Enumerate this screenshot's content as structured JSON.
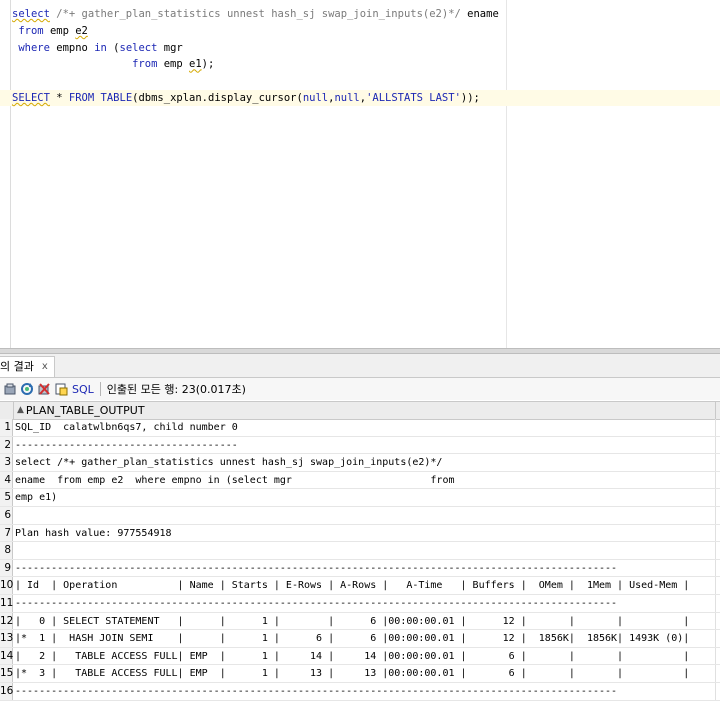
{
  "editor": {
    "lines": [
      {
        "parts": [
          {
            "t": "select",
            "c": "kw squig"
          },
          {
            "t": " "
          },
          {
            "t": "/*+ gather_plan_statistics unnest hash_sj swap_join_inputs(e2)*/",
            "c": "cm"
          },
          {
            "t": " ename"
          }
        ]
      },
      {
        "parts": [
          {
            "t": " "
          },
          {
            "t": "from",
            "c": "kw"
          },
          {
            "t": " emp "
          },
          {
            "t": "e2",
            "c": "squig"
          }
        ]
      },
      {
        "parts": [
          {
            "t": " "
          },
          {
            "t": "where",
            "c": "kw"
          },
          {
            "t": " empno "
          },
          {
            "t": "in",
            "c": "kw"
          },
          {
            "t": " ("
          },
          {
            "t": "select",
            "c": "kw"
          },
          {
            "t": " mgr"
          }
        ]
      },
      {
        "parts": [
          {
            "t": "                   "
          },
          {
            "t": "from",
            "c": "kw"
          },
          {
            "t": " emp "
          },
          {
            "t": "e1",
            "c": "squig"
          },
          {
            "t": ");"
          }
        ]
      },
      {
        "parts": []
      },
      {
        "parts": [
          {
            "t": "SELECT",
            "c": "kw squig"
          },
          {
            "t": " * "
          },
          {
            "t": "FROM",
            "c": "kw"
          },
          {
            "t": " "
          },
          {
            "t": "TABLE",
            "c": "kw"
          },
          {
            "t": "(dbms_xplan.display_cursor("
          },
          {
            "t": "null",
            "c": "kw"
          },
          {
            "t": ","
          },
          {
            "t": "null",
            "c": "kw"
          },
          {
            "t": ","
          },
          {
            "t": "'ALLSTATS LAST'",
            "c": "str"
          },
          {
            "t": "));"
          }
        ],
        "current": true
      }
    ]
  },
  "results": {
    "tab_label": "의 결과",
    "tab_close": "x",
    "toolbar": {
      "sql_label": "SQL",
      "fetch_status": "인출된 모든 행: 23(0.017초)"
    },
    "column_header": "PLAN_TABLE_OUTPUT",
    "rows": [
      {
        "n": "1",
        "text": "SQL_ID  calatwlbn6qs7, child number 0"
      },
      {
        "n": "2",
        "text": "-------------------------------------"
      },
      {
        "n": "3",
        "text": "select /*+ gather_plan_statistics unnest hash_sj swap_join_inputs(e2)*/"
      },
      {
        "n": "4",
        "text": "ename  from emp e2  where empno in (select mgr                       from"
      },
      {
        "n": "5",
        "text": "emp e1)"
      },
      {
        "n": "6",
        "text": ""
      },
      {
        "n": "7",
        "text": "Plan hash value: 977554918"
      },
      {
        "n": "8",
        "text": ""
      },
      {
        "n": "9",
        "text": "----------------------------------------------------------------------------------------------------"
      },
      {
        "n": "10",
        "text": "| Id  | Operation          | Name | Starts | E-Rows | A-Rows |   A-Time   | Buffers |  OMem |  1Mem | Used-Mem |"
      },
      {
        "n": "11",
        "text": "----------------------------------------------------------------------------------------------------"
      },
      {
        "n": "12",
        "text": "|   0 | SELECT STATEMENT   |      |      1 |        |      6 |00:00:00.01 |      12 |       |       |          |"
      },
      {
        "n": "13",
        "text": "|*  1 |  HASH JOIN SEMI    |      |      1 |      6 |      6 |00:00:00.01 |      12 |  1856K|  1856K| 1493K (0)|"
      },
      {
        "n": "14",
        "text": "|   2 |   TABLE ACCESS FULL| EMP  |      1 |     14 |     14 |00:00:00.01 |       6 |       |       |          |"
      },
      {
        "n": "15",
        "text": "|*  3 |   TABLE ACCESS FULL| EMP  |      1 |     13 |     13 |00:00:00.01 |       6 |       |       |          |"
      },
      {
        "n": "16",
        "text": "----------------------------------------------------------------------------------------------------"
      }
    ]
  }
}
